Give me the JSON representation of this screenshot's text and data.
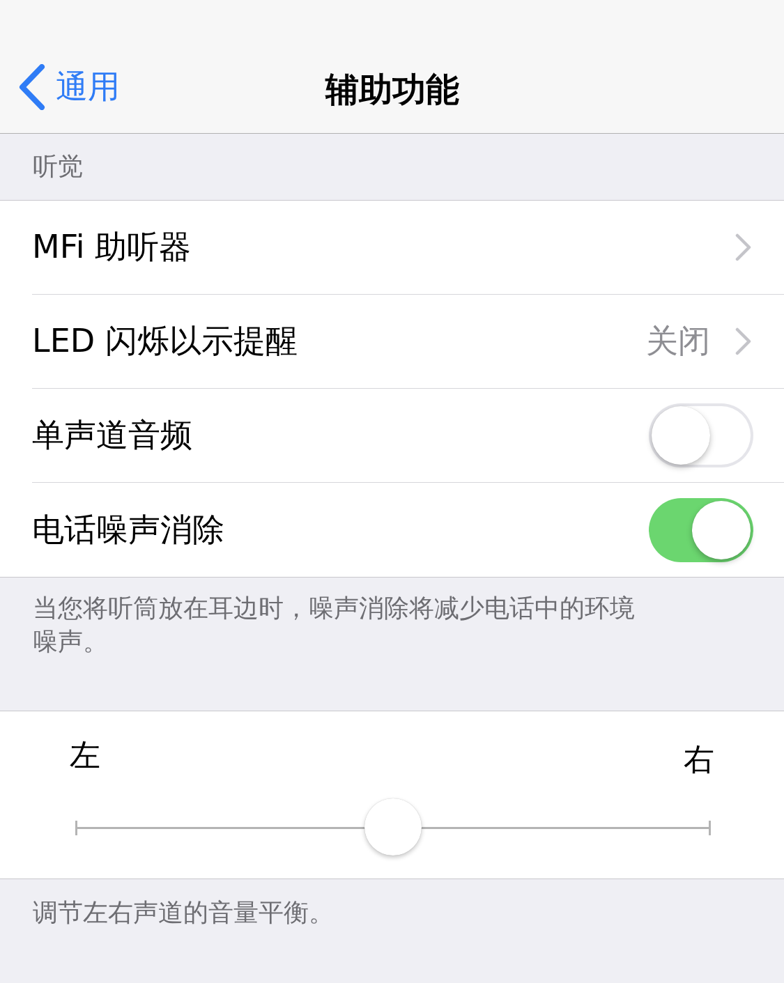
{
  "nav": {
    "back": "通用",
    "title": "辅助功能"
  },
  "section_header": "听觉",
  "rows": [
    {
      "kind": "link",
      "label": "MFi 助听器"
    },
    {
      "kind": "link",
      "label": "LED 闪烁以示提醒",
      "value": "关闭"
    },
    {
      "kind": "toggle",
      "label": "单声道音频",
      "on": false
    },
    {
      "kind": "toggle",
      "label": "电话噪声消除",
      "on": true
    }
  ],
  "footer": "当您将听筒放在耳边时，噪声消除将减少电话中的环境噪声。",
  "balance": {
    "left_label": "左",
    "right_label": "右",
    "level": 0.5
  },
  "balance_footer": "调节左右声道的音量平衡。"
}
